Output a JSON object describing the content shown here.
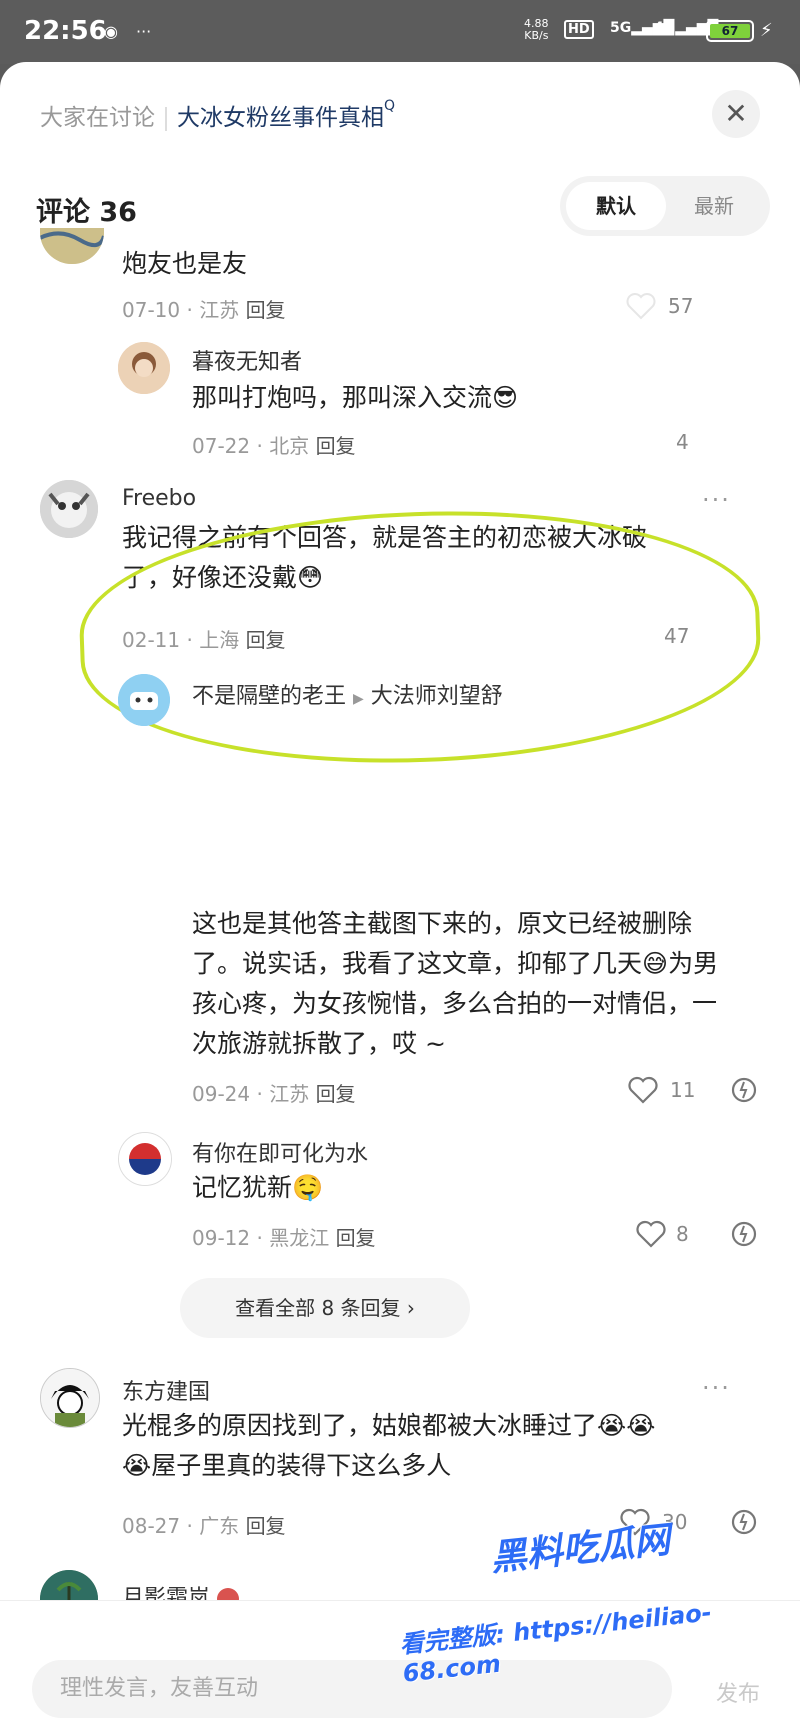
{
  "status": {
    "time": "22:56",
    "net_speed": "4.88",
    "net_unit": "KB/s",
    "hd": "HD",
    "sig1": "5G",
    "sig2": "4G",
    "battery": "67"
  },
  "topic": {
    "prefix": "大家在讨论",
    "title": "大冰女粉丝事件真相",
    "q": "Q"
  },
  "header": {
    "count_label": "评论 36",
    "sort_default": "默认",
    "sort_newest": "最新"
  },
  "comments": [
    {
      "text": "炮友也是友",
      "date": "07-10",
      "region": "江苏",
      "reply": "回复",
      "likes": "57"
    },
    {
      "name": "暮夜无知者",
      "text": "那叫打炮吗，那叫深入交流😎",
      "date": "07-22",
      "region": "北京",
      "reply": "回复",
      "likes": "4"
    },
    {
      "name": "Freebo",
      "line1": "我记得之前有个回答，就是答主的初恋被大冰破",
      "line2": "了，好像还没戴😳",
      "date": "02-11",
      "region": "上海",
      "reply": "回复",
      "likes": "47"
    },
    {
      "name": "不是隔壁的老王",
      "to": "大法师刘望舒",
      "line1": "这也是其他答主截图下来的，原文已经被删除",
      "line2": "了。说实话，我看了这文章，抑郁了几天😅为男",
      "line3": "孩心疼，为女孩惋惜，多么合拍的一对情侣，一",
      "line4": "次旅游就拆散了，哎 ~",
      "date": "09-24",
      "region": "江苏",
      "reply": "回复",
      "likes": "11"
    },
    {
      "name": "有你在即可化为水",
      "text": "记忆犹新🤤",
      "date": "09-12",
      "region": "黑龙江",
      "reply": "回复",
      "likes": "8"
    },
    {
      "name": "东方建国",
      "line1": "光棍多的原因找到了，姑娘都被大冰睡过了😭😭",
      "line2": "😭屋子里真的装得下这么多人",
      "date": "08-27",
      "region": "广东",
      "reply": "回复",
      "likes": "30"
    },
    {
      "name": "月影霜岚"
    }
  ],
  "view_all": "查看全部 8 条回复 ›",
  "watermark": {
    "brand": "黑料吃瓜网",
    "site": "看完整版: https://heiliao-68.com"
  },
  "input": {
    "placeholder": "理性发言，友善互动",
    "publish": "发布"
  },
  "colors": {
    "highlight": "#c7e12a",
    "topic": "#1f3a66"
  }
}
